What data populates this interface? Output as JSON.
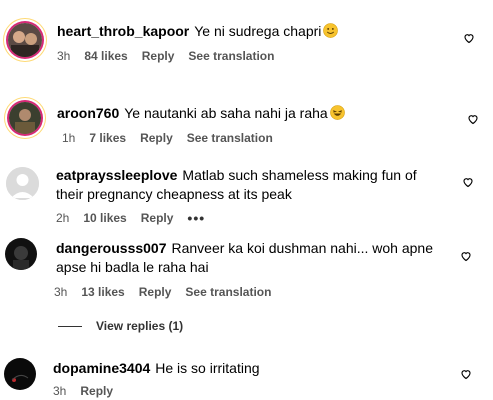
{
  "comments": [
    {
      "username": "heart_throb_kapoor",
      "text": "Ye ni sudrega chapri",
      "emoji": "smile",
      "time": "3h",
      "likes": "84 likes",
      "reply": "Reply",
      "translate": "See translation"
    },
    {
      "username": "aroon760",
      "text": "Ye nautanki ab saha nahi ja raha",
      "emoji": "laugh",
      "time": "1h",
      "likes": "7 likes",
      "reply": "Reply",
      "translate": "See translation"
    },
    {
      "username": "eatprayssleeplove",
      "text": "Matlab such shameless making fun of their pregnancy cheapness at its peak",
      "time": "2h",
      "likes": "10 likes",
      "reply": "Reply",
      "more": "•••"
    },
    {
      "username": "dangerousss007",
      "text": "Ranveer ka koi dushman nahi... woh apne apse hi badla le raha hai",
      "time": "3h",
      "likes": "13 likes",
      "reply": "Reply",
      "translate": "See translation"
    },
    {
      "username": "dopamine3404",
      "text": "He is so irritating",
      "time": "3h",
      "reply": "Reply"
    }
  ],
  "view_replies": "View replies (1)",
  "colors": {
    "meta": "#555555",
    "ring_pink": "#d62976",
    "ring_yellow": "#feda75"
  }
}
